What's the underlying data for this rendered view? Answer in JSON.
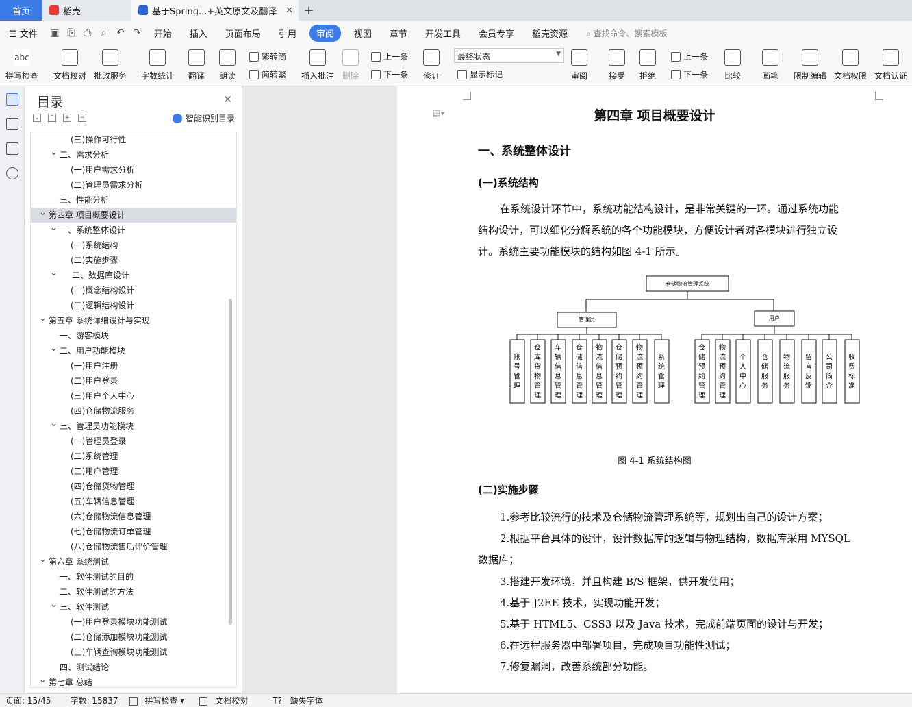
{
  "tabs": {
    "home": "首页",
    "doc1": "稻壳",
    "doc2": "基于Spring...+英文原文及翻译",
    "add": "+"
  },
  "menu": {
    "file": "文件",
    "items": [
      "开始",
      "插入",
      "页面布局",
      "引用",
      "审阅",
      "视图",
      "章节",
      "开发工具",
      "会员专享",
      "稻壳资源"
    ],
    "active": "审阅",
    "search": "查找命令、搜索模板"
  },
  "ribbon": {
    "spell": "拼写检查",
    "proof": "文档校对",
    "batch": "批改服务",
    "wordcount": "字数统计",
    "translate": "翻译",
    "read": "朗读",
    "trad": "繁转简",
    "simp": "简转繁",
    "insert_comment": "插入批注",
    "delete": "删除",
    "prev": "上一条",
    "next": "下一条",
    "revise": "修订",
    "state": "最终状态",
    "show_marks": "显示标记",
    "review": "审阅",
    "accept": "接受",
    "reject": "拒绝",
    "prev2": "上一条",
    "next2": "下一条",
    "compare": "比较",
    "pen": "画笔",
    "limit": "限制编辑",
    "doc_perm": "文档权限",
    "doc_cert": "文档认证",
    "abc": "abc"
  },
  "toc": {
    "title": "目录",
    "smart": "智能识别目录",
    "items": [
      {
        "t": "(三)操作可行性",
        "l": 3,
        "c": ""
      },
      {
        "t": "二、需求分析",
        "l": 2,
        "c": "v"
      },
      {
        "t": "(一)用户需求分析",
        "l": 3,
        "c": ""
      },
      {
        "t": "(二)管理员需求分析",
        "l": 3,
        "c": ""
      },
      {
        "t": "三、性能分析",
        "l": 2,
        "c": ""
      },
      {
        "t": "第四章  项目概要设计",
        "l": 1,
        "c": "v",
        "sel": true
      },
      {
        "t": "一、系统整体设计",
        "l": 2,
        "c": "v"
      },
      {
        "t": "(一)系统结构",
        "l": 3,
        "c": ""
      },
      {
        "t": "(二)实施步骤",
        "l": 3,
        "c": ""
      },
      {
        "t": "二、数据库设计",
        "l": 2.5,
        "c": "v"
      },
      {
        "t": "(一)概念结构设计",
        "l": 3,
        "c": ""
      },
      {
        "t": "(二)逻辑结构设计",
        "l": 3,
        "c": ""
      },
      {
        "t": "第五章  系统详细设计与实现",
        "l": 1,
        "c": "v"
      },
      {
        "t": "一、游客模块",
        "l": 2,
        "c": ""
      },
      {
        "t": "二、用户功能模块",
        "l": 2,
        "c": "v"
      },
      {
        "t": "(一)用户注册",
        "l": 3,
        "c": ""
      },
      {
        "t": "(二)用户登录",
        "l": 3,
        "c": ""
      },
      {
        "t": "(三)用户个人中心",
        "l": 3,
        "c": ""
      },
      {
        "t": "(四)仓储物流服务",
        "l": 3,
        "c": ""
      },
      {
        "t": "三、管理员功能模块",
        "l": 2,
        "c": "v"
      },
      {
        "t": "(一)管理员登录",
        "l": 3,
        "c": ""
      },
      {
        "t": "(二)系统管理",
        "l": 3,
        "c": ""
      },
      {
        "t": "(三)用户管理",
        "l": 3,
        "c": ""
      },
      {
        "t": "(四)仓储货物管理",
        "l": 3,
        "c": ""
      },
      {
        "t": "(五)车辆信息管理",
        "l": 3,
        "c": ""
      },
      {
        "t": "(六)仓储物流信息管理",
        "l": 3,
        "c": ""
      },
      {
        "t": "(七)仓储物流订单管理",
        "l": 3,
        "c": ""
      },
      {
        "t": "(八)仓储物流售后评价管理",
        "l": 3,
        "c": ""
      },
      {
        "t": "第六章  系统测试",
        "l": 1,
        "c": "v"
      },
      {
        "t": "一、软件测试的目的",
        "l": 2,
        "c": ""
      },
      {
        "t": "二、软件测试的方法",
        "l": 2,
        "c": ""
      },
      {
        "t": "三、软件测试",
        "l": 2,
        "c": "v"
      },
      {
        "t": "(一)用户登录模块功能测试",
        "l": 3,
        "c": ""
      },
      {
        "t": "(二)仓储添加模块功能测试",
        "l": 3,
        "c": ""
      },
      {
        "t": "(三)车辆查询模块功能测试",
        "l": 3,
        "c": ""
      },
      {
        "t": "四、测试结论",
        "l": 2,
        "c": ""
      },
      {
        "t": "第七章  总结",
        "l": 1,
        "c": "v"
      }
    ]
  },
  "doc": {
    "h1": "第四章  项目概要设计",
    "h2": "一、系统整体设计",
    "h3a": "(一)系统结构",
    "para1": [
      "在系统设计环节中，系统功能结构设计，是非常关键的一环。通过系统功能",
      "结构设计，可以细化分解系统的各个功能模块，方便设计者对各模块进行独立设",
      "计。系统主要功能模块的结构如图 4-1 所示。"
    ],
    "caption": "图 4-1 系统结构图",
    "h3b": "(二)实施步骤",
    "steps": [
      "1.参考比较流行的技术及仓储物流管理系统等，规划出自己的设计方案；",
      "2.根据平台具体的设计，设计数据库的逻辑与物理结构，数据库采用 MYSQL",
      "数据库；",
      "3.搭建开发环境，并且构建 B/S 框架，供开发使用；",
      "4.基于 J2EE 技术，实现功能开发；",
      "5.基于 HTML5、CSS3 以及 Java 技术，完成前端页面的设计与开发；",
      "6.在远程服务器中部署项目，完成项目功能性测试；",
      "7.修复漏洞，改善系统部分功能。"
    ]
  },
  "diagram": {
    "root": "仓储物流管理系统",
    "admin": "管理员",
    "user": "用户",
    "admin_leaves": [
      "账号管理",
      "仓库货物管理",
      "车辆信息管理",
      "仓储信息管理",
      "物流信息管理",
      "仓储预约管理",
      "物流预约管理",
      "系统管理"
    ],
    "user_leaves": [
      "仓储预约管理",
      "物流预约管理",
      "个人中心",
      "仓储服务",
      "物流服务",
      "留言反馈",
      "公司简介",
      "收费标准"
    ]
  },
  "status": {
    "page": "页面: 15/45",
    "words": "字数: 15837",
    "spell": "拼写检查",
    "proof": "文档校对",
    "font": "缺失字体"
  }
}
